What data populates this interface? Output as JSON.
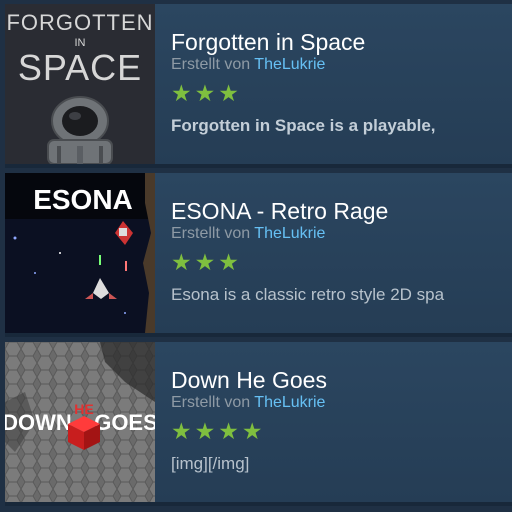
{
  "items": [
    {
      "title": "Forgotten in Space",
      "creator_prefix": "Erstellt von",
      "creator_name": "TheLukrie",
      "stars": "★★★",
      "rating": 3,
      "description": "Forgotten in Space is a playable,",
      "thumb_title_top": "FORGOTTEN",
      "thumb_title_mid": "IN",
      "thumb_title_bottom": "SPACE"
    },
    {
      "title": "ESONA - Retro Rage",
      "creator_prefix": "Erstellt von",
      "creator_name": "TheLukrie",
      "stars": "★★★",
      "rating": 3,
      "description": "Esona is a classic retro style 2D spa",
      "thumb_title": "ESONA"
    },
    {
      "title": "Down He Goes",
      "creator_prefix": "Erstellt von",
      "creator_name": "TheLukrie",
      "stars": "★★★★",
      "rating": 4,
      "description": "[img][/img]",
      "thumb_left": "DOWN",
      "thumb_he": "HE",
      "thumb_right": "GOES"
    }
  ],
  "colors": {
    "background": "#1b2838",
    "title": "#ffffff",
    "creator_link": "#66c0f4",
    "stars": "#7fbf3f"
  }
}
